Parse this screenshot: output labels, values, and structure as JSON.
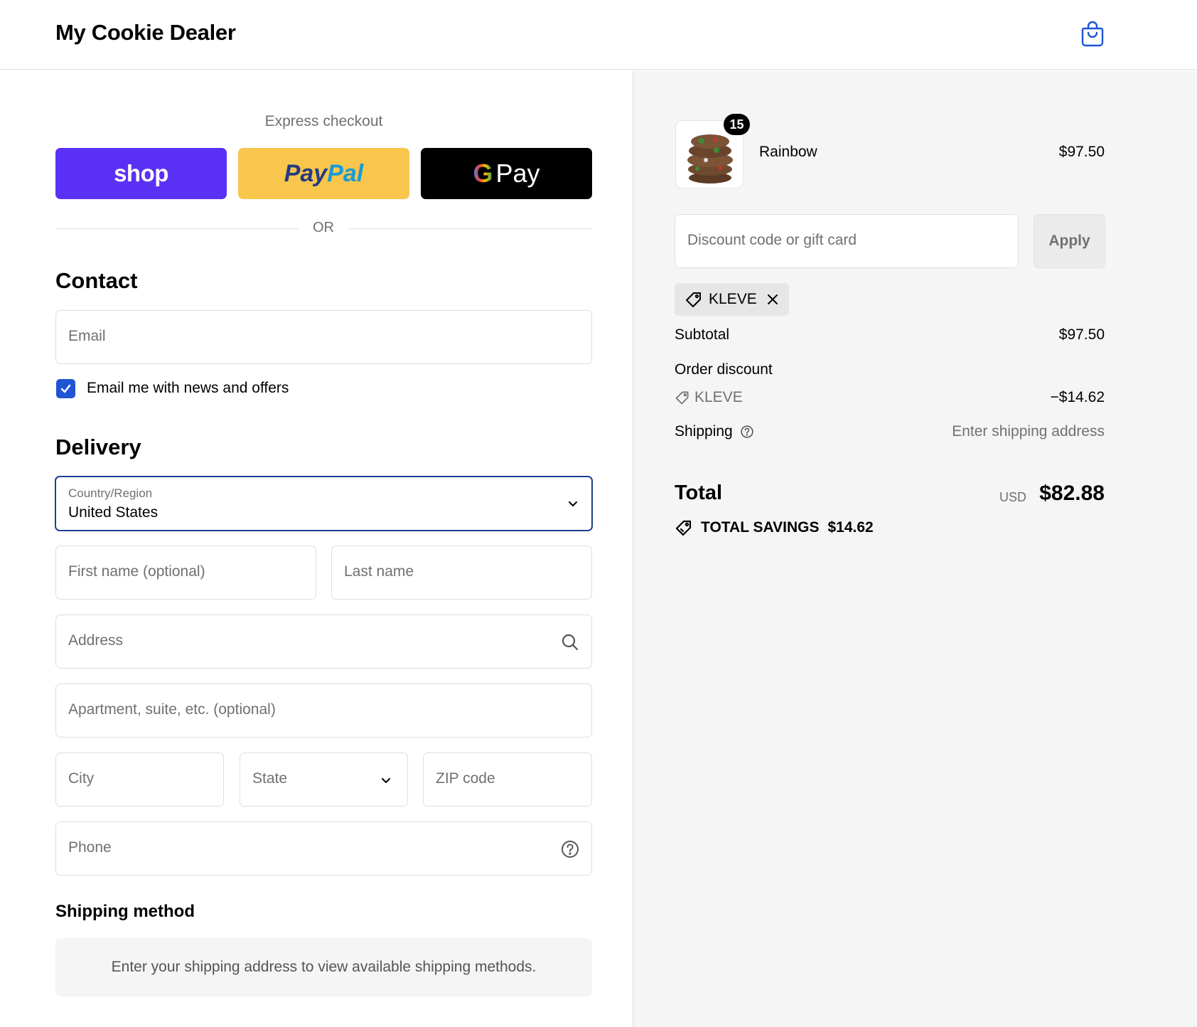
{
  "header": {
    "store_name": "My Cookie Dealer",
    "cart_icon": "shopping-bag-icon"
  },
  "express": {
    "title": "Express checkout",
    "shop_label": "shop",
    "paypal_part1": "Pay",
    "paypal_part2": "Pal",
    "gpay_g": "G",
    "gpay_label": "Pay",
    "or_label": "OR"
  },
  "contact": {
    "title": "Contact",
    "email_placeholder": "Email",
    "newsletter_label": "Email me with news and offers",
    "newsletter_checked": true
  },
  "delivery": {
    "title": "Delivery",
    "country_label": "Country/Region",
    "country_value": "United States",
    "first_name_placeholder": "First name (optional)",
    "last_name_placeholder": "Last name",
    "address_placeholder": "Address",
    "apartment_placeholder": "Apartment, suite, etc. (optional)",
    "city_placeholder": "City",
    "state_placeholder": "State",
    "zip_placeholder": "ZIP code",
    "phone_placeholder": "Phone"
  },
  "shipping_method": {
    "title": "Shipping method",
    "note": "Enter your shipping address to view available shipping methods."
  },
  "summary": {
    "product": {
      "name": "Rainbow",
      "quantity": "15",
      "price": "$97.50"
    },
    "discount_placeholder": "Discount code or gift card",
    "apply_label": "Apply",
    "applied_code": "KLEVE",
    "subtotal_label": "Subtotal",
    "subtotal_value": "$97.50",
    "order_discount_label": "Order discount",
    "order_discount_code": "KLEVE",
    "order_discount_value": "−$14.62",
    "shipping_label": "Shipping",
    "shipping_value": "Enter shipping address",
    "total_label": "Total",
    "total_currency": "USD",
    "total_value": "$82.88",
    "savings_label": "TOTAL SAVINGS",
    "savings_value": "$14.62"
  },
  "colors": {
    "shop_purple": "#5a31f4",
    "paypal_yellow": "#f8c64d",
    "accent_blue": "#1f55d4",
    "focus_border": "#1f3f94"
  }
}
